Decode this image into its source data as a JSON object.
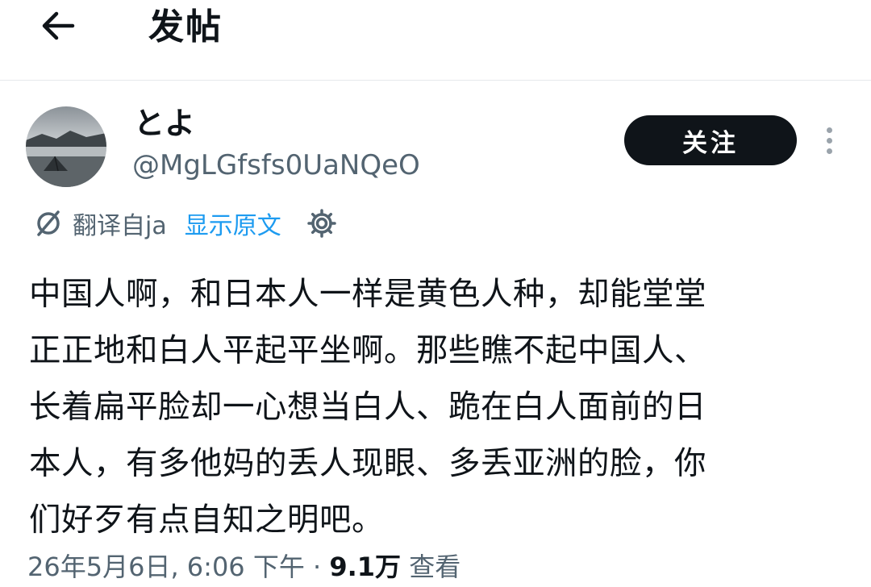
{
  "header": {
    "back_icon": "arrow-left-icon",
    "title": "发帖"
  },
  "author": {
    "avatar_icon": "avatar-landscape",
    "display_name": "とよ",
    "handle": "@MgLGfsfs0UaNQeO"
  },
  "actions": {
    "follow_label": "关注",
    "more_icon": "vertical-dots-icon"
  },
  "translation": {
    "icon": "translate-icon",
    "label": "翻译自ja",
    "show_original_label": "显示原文",
    "settings_icon": "gear-icon"
  },
  "post": {
    "text": "中国人啊，和日本人一样是黄色人种，却能堂堂\n正正地和白人平起平坐啊。那些瞧不起中国人、\n长着扁平脸却一心想当白人、跪在白人面前的日\n本人，有多他妈的丢人现眼、多丢亚洲的脸，你\n们好歹有点自知之明吧。"
  },
  "meta": {
    "date": "26年5月6日",
    "separator1": ", ",
    "time": "6:06 下午",
    "separator2": " · ",
    "view_count": "9.1万",
    "view_label": " 查看"
  },
  "colors": {
    "text_primary": "#0f1419",
    "text_secondary": "#536471",
    "link": "#1d9bf0",
    "follow_bg": "#0f1419",
    "divider": "#e6e9ec"
  }
}
